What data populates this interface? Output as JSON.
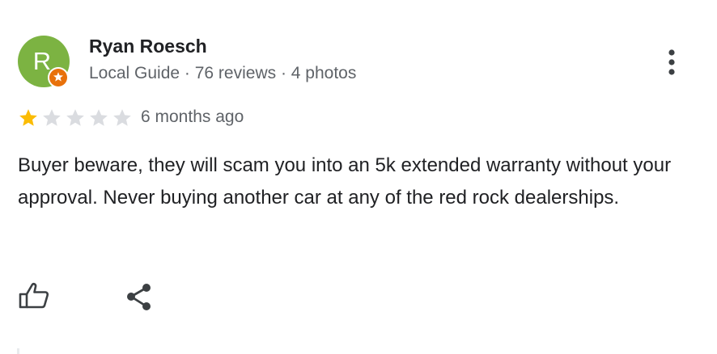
{
  "reviewer": {
    "initial": "R",
    "name": "Ryan Roesch",
    "meta": "Local Guide · 76 reviews · 4 photos",
    "avatar_color": "#7cb342",
    "badge_color": "#e8710a",
    "badge_icon": "local-guide-star-icon"
  },
  "rating": {
    "stars": 1,
    "out_of": 5,
    "filled_color": "#fbbc04",
    "empty_color": "#dadce0",
    "time": "6 months ago"
  },
  "review": {
    "text": "Buyer beware, they will scam you into an 5k extended warranty without your approval. Never buying another car at any of the red rock dealerships."
  },
  "actions": {
    "like_icon": "thumbs-up-icon",
    "share_icon": "share-icon",
    "more_icon": "more-vert-icon"
  }
}
